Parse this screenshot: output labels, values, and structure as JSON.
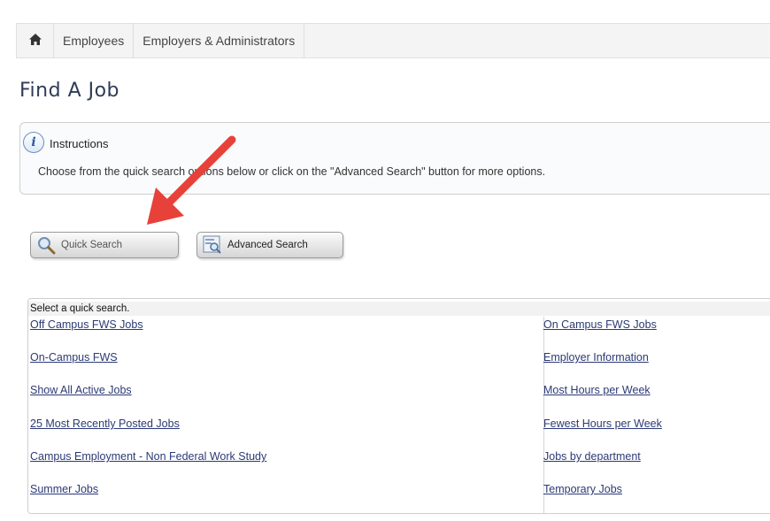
{
  "nav": {
    "home_icon": "home-icon",
    "items": [
      {
        "label": "Employees"
      },
      {
        "label": "Employers & Administrators"
      }
    ]
  },
  "page": {
    "title": "Find A Job"
  },
  "instructions": {
    "icon": "info-icon",
    "icon_glyph": "i",
    "title": "Instructions",
    "text": "Choose from the quick search options below or click on the \"Advanced Search\" button for more options."
  },
  "buttons": {
    "quick_search": {
      "label": "Quick Search",
      "icon": "magnifier-icon"
    },
    "advanced_search": {
      "label": "Advanced Search",
      "icon": "advanced-search-icon"
    }
  },
  "quick_search": {
    "header": "Select a quick search.",
    "left_links": [
      "Off Campus FWS Jobs",
      "On-Campus FWS",
      "Show All Active Jobs",
      "25 Most Recently Posted Jobs",
      "Campus Employment - Non Federal Work Study",
      "Summer Jobs"
    ],
    "right_links": [
      "On Campus FWS Jobs",
      "Employer Information",
      "Most Hours per Week",
      "Fewest Hours per Week",
      "Jobs by department",
      "Temporary Jobs"
    ]
  },
  "annotation": {
    "arrow_color": "#e8413a"
  }
}
